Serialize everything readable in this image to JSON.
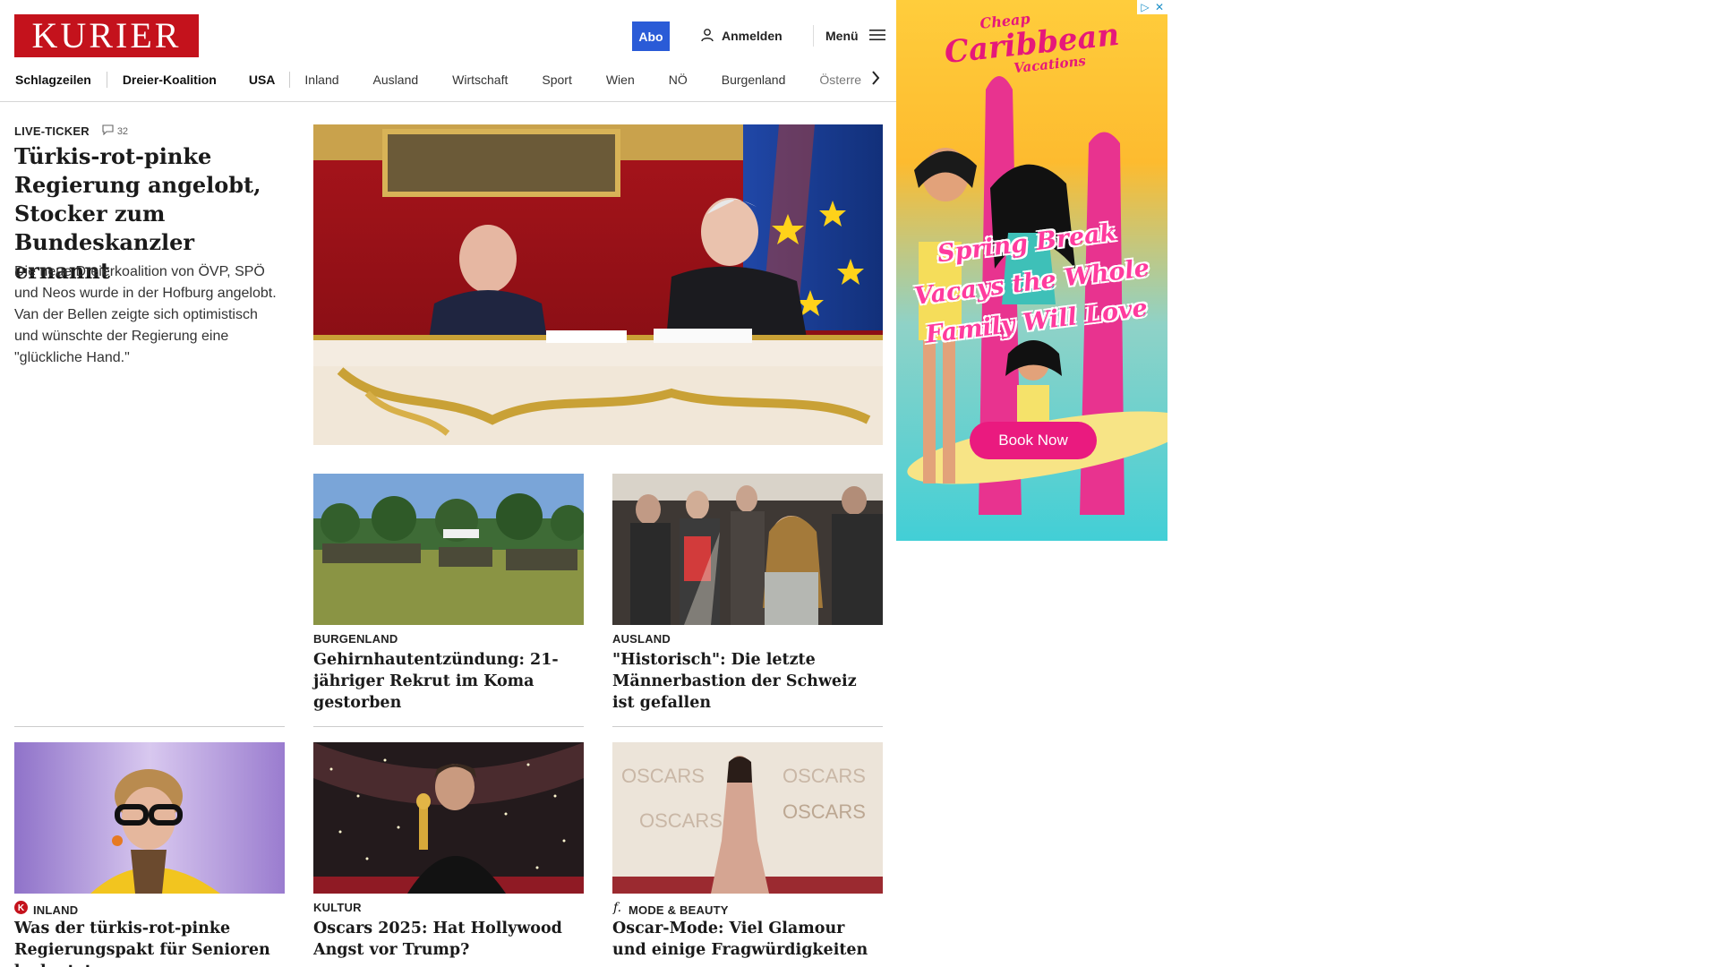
{
  "header": {
    "logo": "KURIER",
    "abo": "Abo",
    "login": "Anmelden",
    "menu": "Menü"
  },
  "nav": {
    "items": [
      "Schlagzeilen",
      "Dreier-Koalition",
      "USA",
      "Inland",
      "Ausland",
      "Wirtschaft",
      "Sport",
      "Wien",
      "NÖ",
      "Burgenland",
      "Österre"
    ]
  },
  "lead": {
    "tag": "LIVE-TICKER",
    "comments": "32",
    "title": "Türkis-rot-pinke Regierung angelobt, Stocker zum Bundeskanzler ernannt",
    "text": "Die neue Dreierkoalition von ÖVP, SPÖ und Neos wurde in der Hofburg angelobt. Van der Bellen zeigte sich optimistisch und wünschte der Regierung eine \"glückliche Hand.\""
  },
  "cards": [
    {
      "tag": "BURGENLAND",
      "title": "Gehirnhautentzündung: 21-jähriger Rekrut im Koma gestorben"
    },
    {
      "tag": "AUSLAND",
      "title": "\"Historisch\": Die letzte Männerbastion der Schweiz ist gefallen"
    },
    {
      "tag": "INLAND",
      "title": "Was der türkis-rot-pinke Regierungspakt für Senioren bedeutet"
    },
    {
      "tag": "KULTUR",
      "title": "Oscars 2025: Hat Hollywood Angst vor Trump?"
    },
    {
      "tag": "MODE & BEAUTY",
      "title": "Oscar-Mode: Viel Glamour und einige Fragwürdigkeiten"
    }
  ],
  "ad": {
    "brand_line1": "Cheap",
    "brand_line2": "Caribbean",
    "brand_line3": "Vacations",
    "slogan": "Spring Break Vacays the Whole Family Will Love",
    "cta": "Book Now"
  },
  "colors": {
    "brand": "#c4121c",
    "abo": "#2a5bd7",
    "ad_pink": "#ea1a7f"
  }
}
